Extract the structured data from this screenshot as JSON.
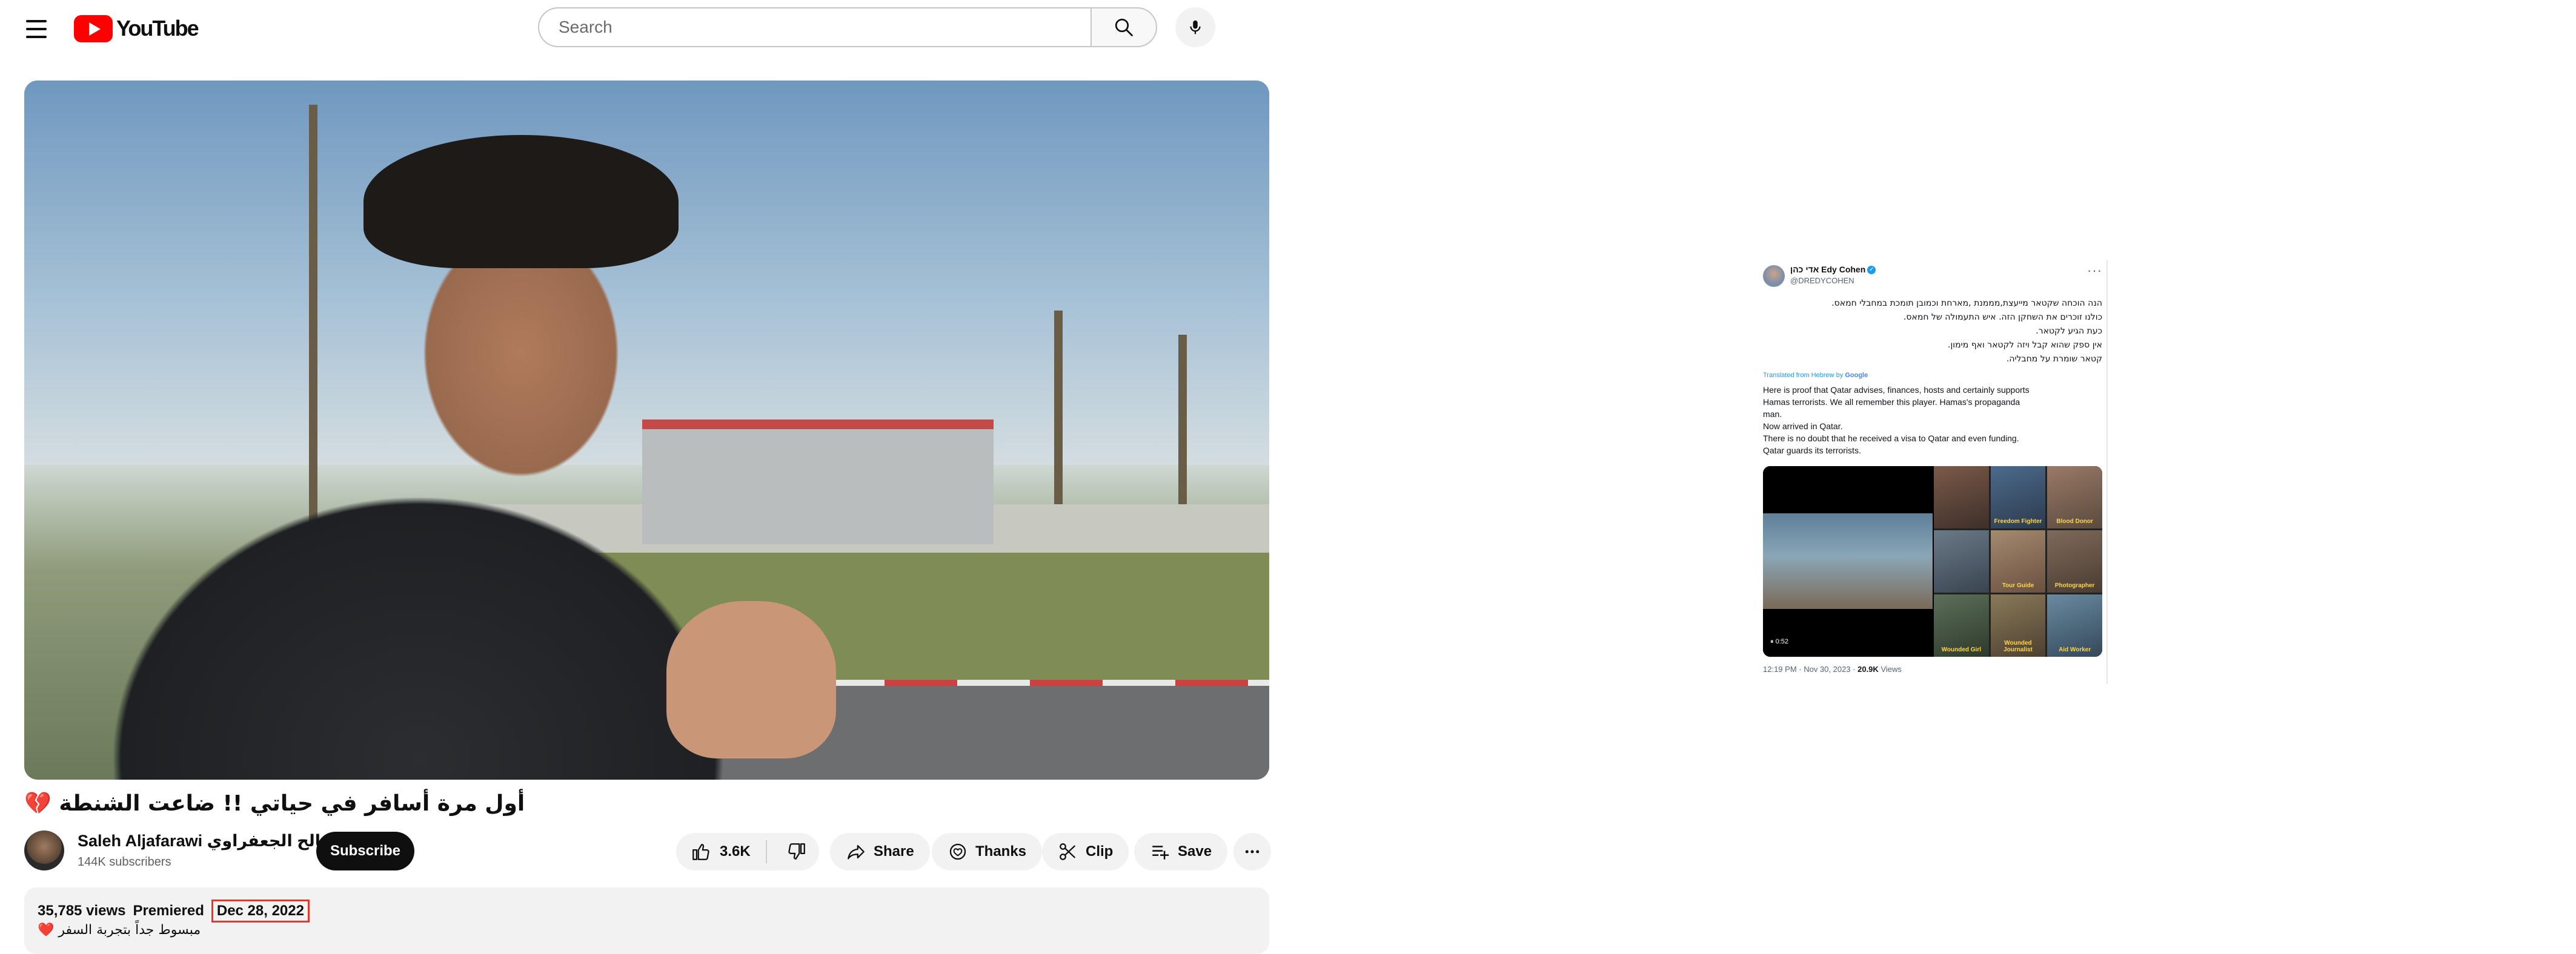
{
  "header": {
    "logo_text": "YouTube",
    "search_placeholder": "Search"
  },
  "video": {
    "title": "أول مرة أسافر في حياتي !! ضاعت الشنطة 💔"
  },
  "channel": {
    "name": "Saleh Aljafarawi صالح الجعفراوي",
    "subscribers": "144K subscribers",
    "subscribe_label": "Subscribe"
  },
  "actions": {
    "likes": "3.6K",
    "share": "Share",
    "thanks": "Thanks",
    "clip": "Clip",
    "save": "Save"
  },
  "description": {
    "views": "35,785 views",
    "premiered": "Premiered",
    "date": "Dec 28, 2022",
    "text": "مبسوط جداً بتجربة السفر ❤️"
  },
  "tweet": {
    "name": "אדי כהן Edy Cohen",
    "handle": "@DREDYCOHEN",
    "hebrew_lines": [
      "הנה הוכחה שקטאר מייעצת,מממנת ,מארחת וכמובן תומכת במחבלי חמאס.",
      "כולנו זוכרים את השחקן הזה. איש התעמולה של חמאס.",
      "כעת הגיע לקטאר.",
      "אין ספק שהוא קבל ויזה לקטאר ואף מימון.",
      "קטאר שומרת על מחבליה."
    ],
    "translated_prefix": "Translated from Hebrew by",
    "translated_brand": "Google",
    "english_lines": [
      "Here is proof that Qatar advises, finances, hosts and certainly supports",
      "Hamas terrorists. We all remember this player. Hamas's propaganda",
      "man.",
      "Now arrived in Qatar.",
      "There is no doubt that he received a visa to Qatar and even funding.",
      "Qatar guards its terrorists."
    ],
    "video_duration": "0:52",
    "grid_labels": [
      "",
      "Freedom Fighter",
      "Blood Donor",
      "",
      "Tour Guide",
      "Photographer",
      "Wounded Girl",
      "Wounded Journalist",
      "Aid Worker"
    ],
    "timestamp": "12:19 PM · Nov 30, 2023 ·",
    "views_count": "20.9K",
    "views_label": "Views"
  }
}
